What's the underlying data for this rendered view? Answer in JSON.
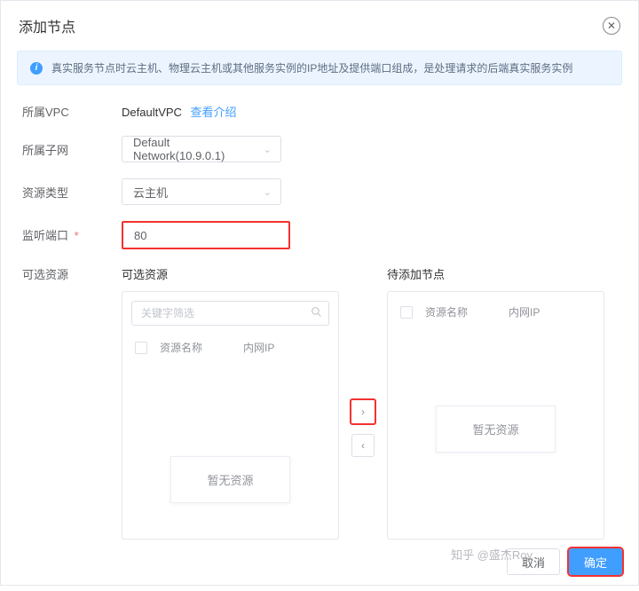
{
  "header": {
    "title": "添加节点"
  },
  "alert": {
    "text": "真实服务节点时云主机、物理云主机或其他服务实例的IP地址及提供端口组成，是处理请求的后端真实服务实例"
  },
  "form": {
    "vpc": {
      "label": "所属VPC",
      "value": "DefaultVPC",
      "link": "查看介绍"
    },
    "subnet": {
      "label": "所属子网",
      "value": "Default Network(10.9.0.1)"
    },
    "resType": {
      "label": "资源类型",
      "value": "云主机"
    },
    "port": {
      "label": "监听端口",
      "required": "*",
      "value": "80"
    }
  },
  "transfer": {
    "outerLabel": "可选资源",
    "left": {
      "title": "可选资源",
      "search_placeholder": "关键字筛选",
      "col_name": "资源名称",
      "col_ip": "内网IP",
      "empty": "暂无资源"
    },
    "right": {
      "title": "待添加节点",
      "col_name": "资源名称",
      "col_ip": "内网IP",
      "empty": "暂无资源"
    }
  },
  "footer": {
    "cancel": "取消",
    "confirm": "确定"
  },
  "watermark": "知乎 @盛杰Roy"
}
